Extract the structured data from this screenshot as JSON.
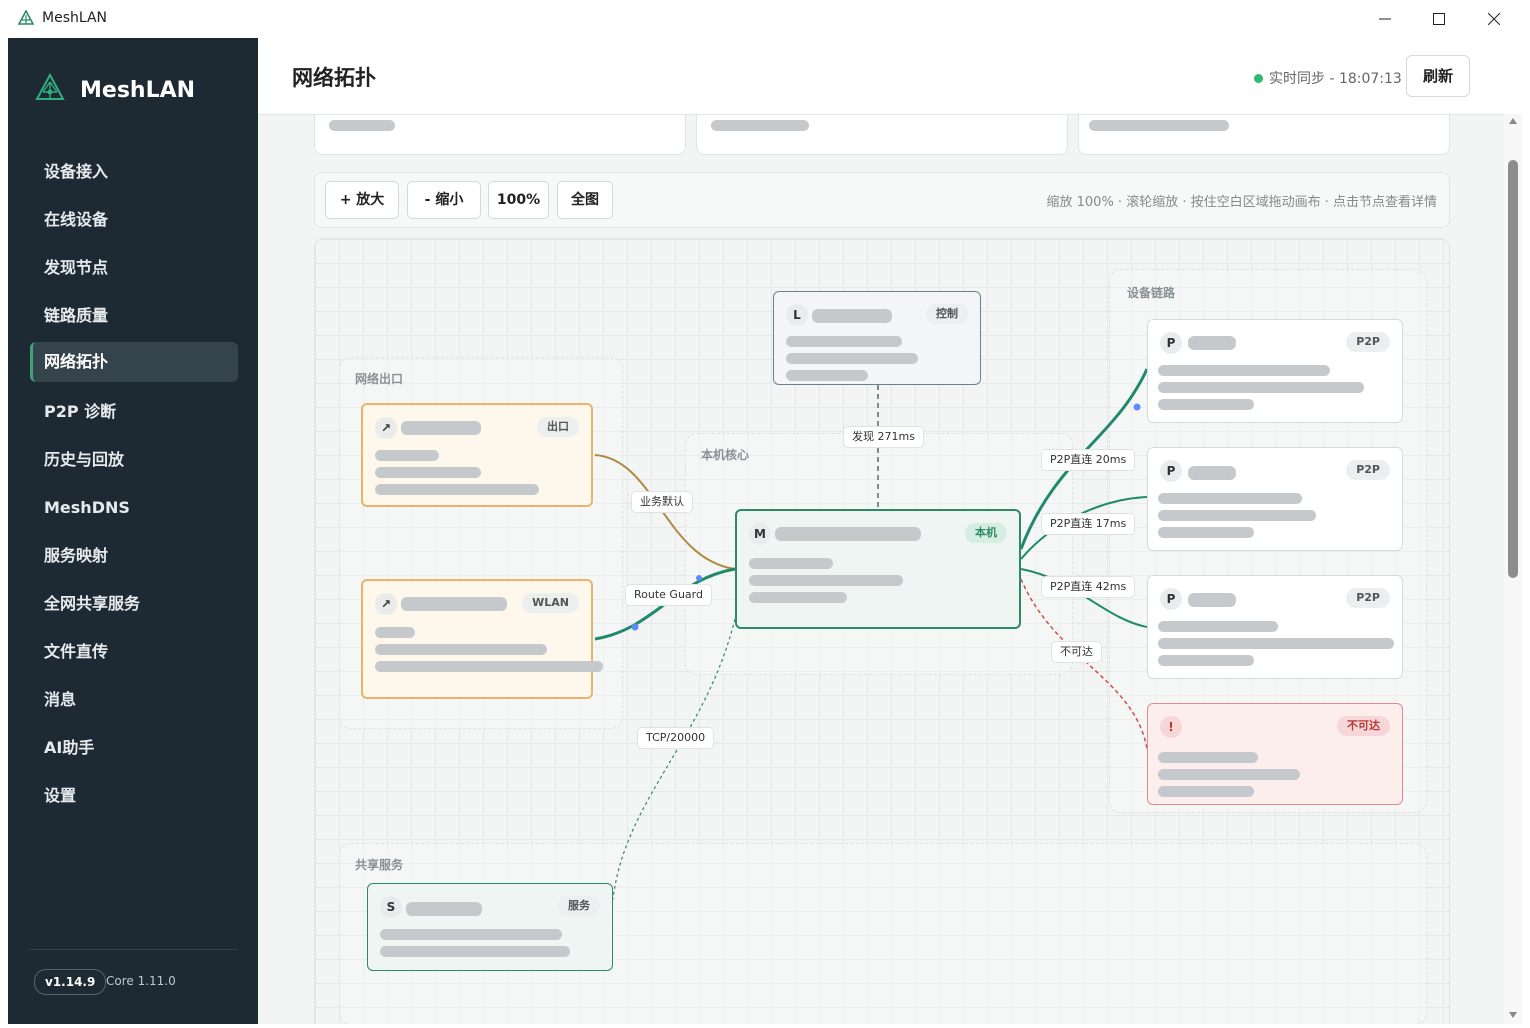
{
  "window": {
    "title": "MeshLAN"
  },
  "sidebar": {
    "brand": "MeshLAN",
    "items": [
      {
        "label": "设备接入"
      },
      {
        "label": "在线设备"
      },
      {
        "label": "发现节点"
      },
      {
        "label": "链路质量"
      },
      {
        "label": "网络拓扑",
        "active": true
      },
      {
        "label": "P2P 诊断"
      },
      {
        "label": "历史与回放"
      },
      {
        "label": "MeshDNS"
      },
      {
        "label": "服务映射"
      },
      {
        "label": "全网共享服务"
      },
      {
        "label": "文件直传"
      },
      {
        "label": "消息"
      },
      {
        "label": "AI助手"
      },
      {
        "label": "设置"
      }
    ],
    "version": "v1.14.9",
    "core": "Core 1.11.0"
  },
  "header": {
    "title": "网络拓扑",
    "sync_text": "实时同步 - 18:07:13",
    "refresh": "刷新"
  },
  "toolbar": {
    "zoom_in": "+ 放大",
    "zoom_out": "- 缩小",
    "zoom_level": "100%",
    "fit": "全图",
    "hint": "缩放 100% · 滚轮缩放 · 按住空白区域拖动画布 · 点击节点查看详情"
  },
  "topology": {
    "groups": {
      "exit": "网络出口",
      "core": "本机核心",
      "devices": "设备链路",
      "shared": "共享服务"
    },
    "nodes": {
      "control": {
        "avatar": "L",
        "tag": "控制"
      },
      "exit1": {
        "avatar": "↗",
        "tag": "出口"
      },
      "exit2": {
        "avatar": "↗",
        "tag": "WLAN"
      },
      "local": {
        "avatar": "M",
        "tag": "本机"
      },
      "peer1": {
        "avatar": "P",
        "tag": "P2P"
      },
      "peer2": {
        "avatar": "P",
        "tag": "P2P"
      },
      "peer3": {
        "avatar": "P",
        "tag": "P2P"
      },
      "unreachable": {
        "avatar": "!",
        "tag": "不可达"
      },
      "service": {
        "avatar": "S",
        "tag": "服务"
      }
    },
    "edges": {
      "discover": "发现 271ms",
      "default_route": "业务默认",
      "route_guard": "Route Guard",
      "p2p1": "P2P直连 20ms",
      "p2p2": "P2P直连 17ms",
      "p2p3": "P2P直连 42ms",
      "unreachable": "不可达",
      "tcp": "TCP/20000"
    }
  },
  "colors": {
    "sidebar_bg": "#1e2a33",
    "accent": "#2e8a64",
    "exit_border": "#e6b46a",
    "exit_fill": "#fdf7ec",
    "error_border": "#e58a8a",
    "error_fill": "#fdeeee"
  }
}
